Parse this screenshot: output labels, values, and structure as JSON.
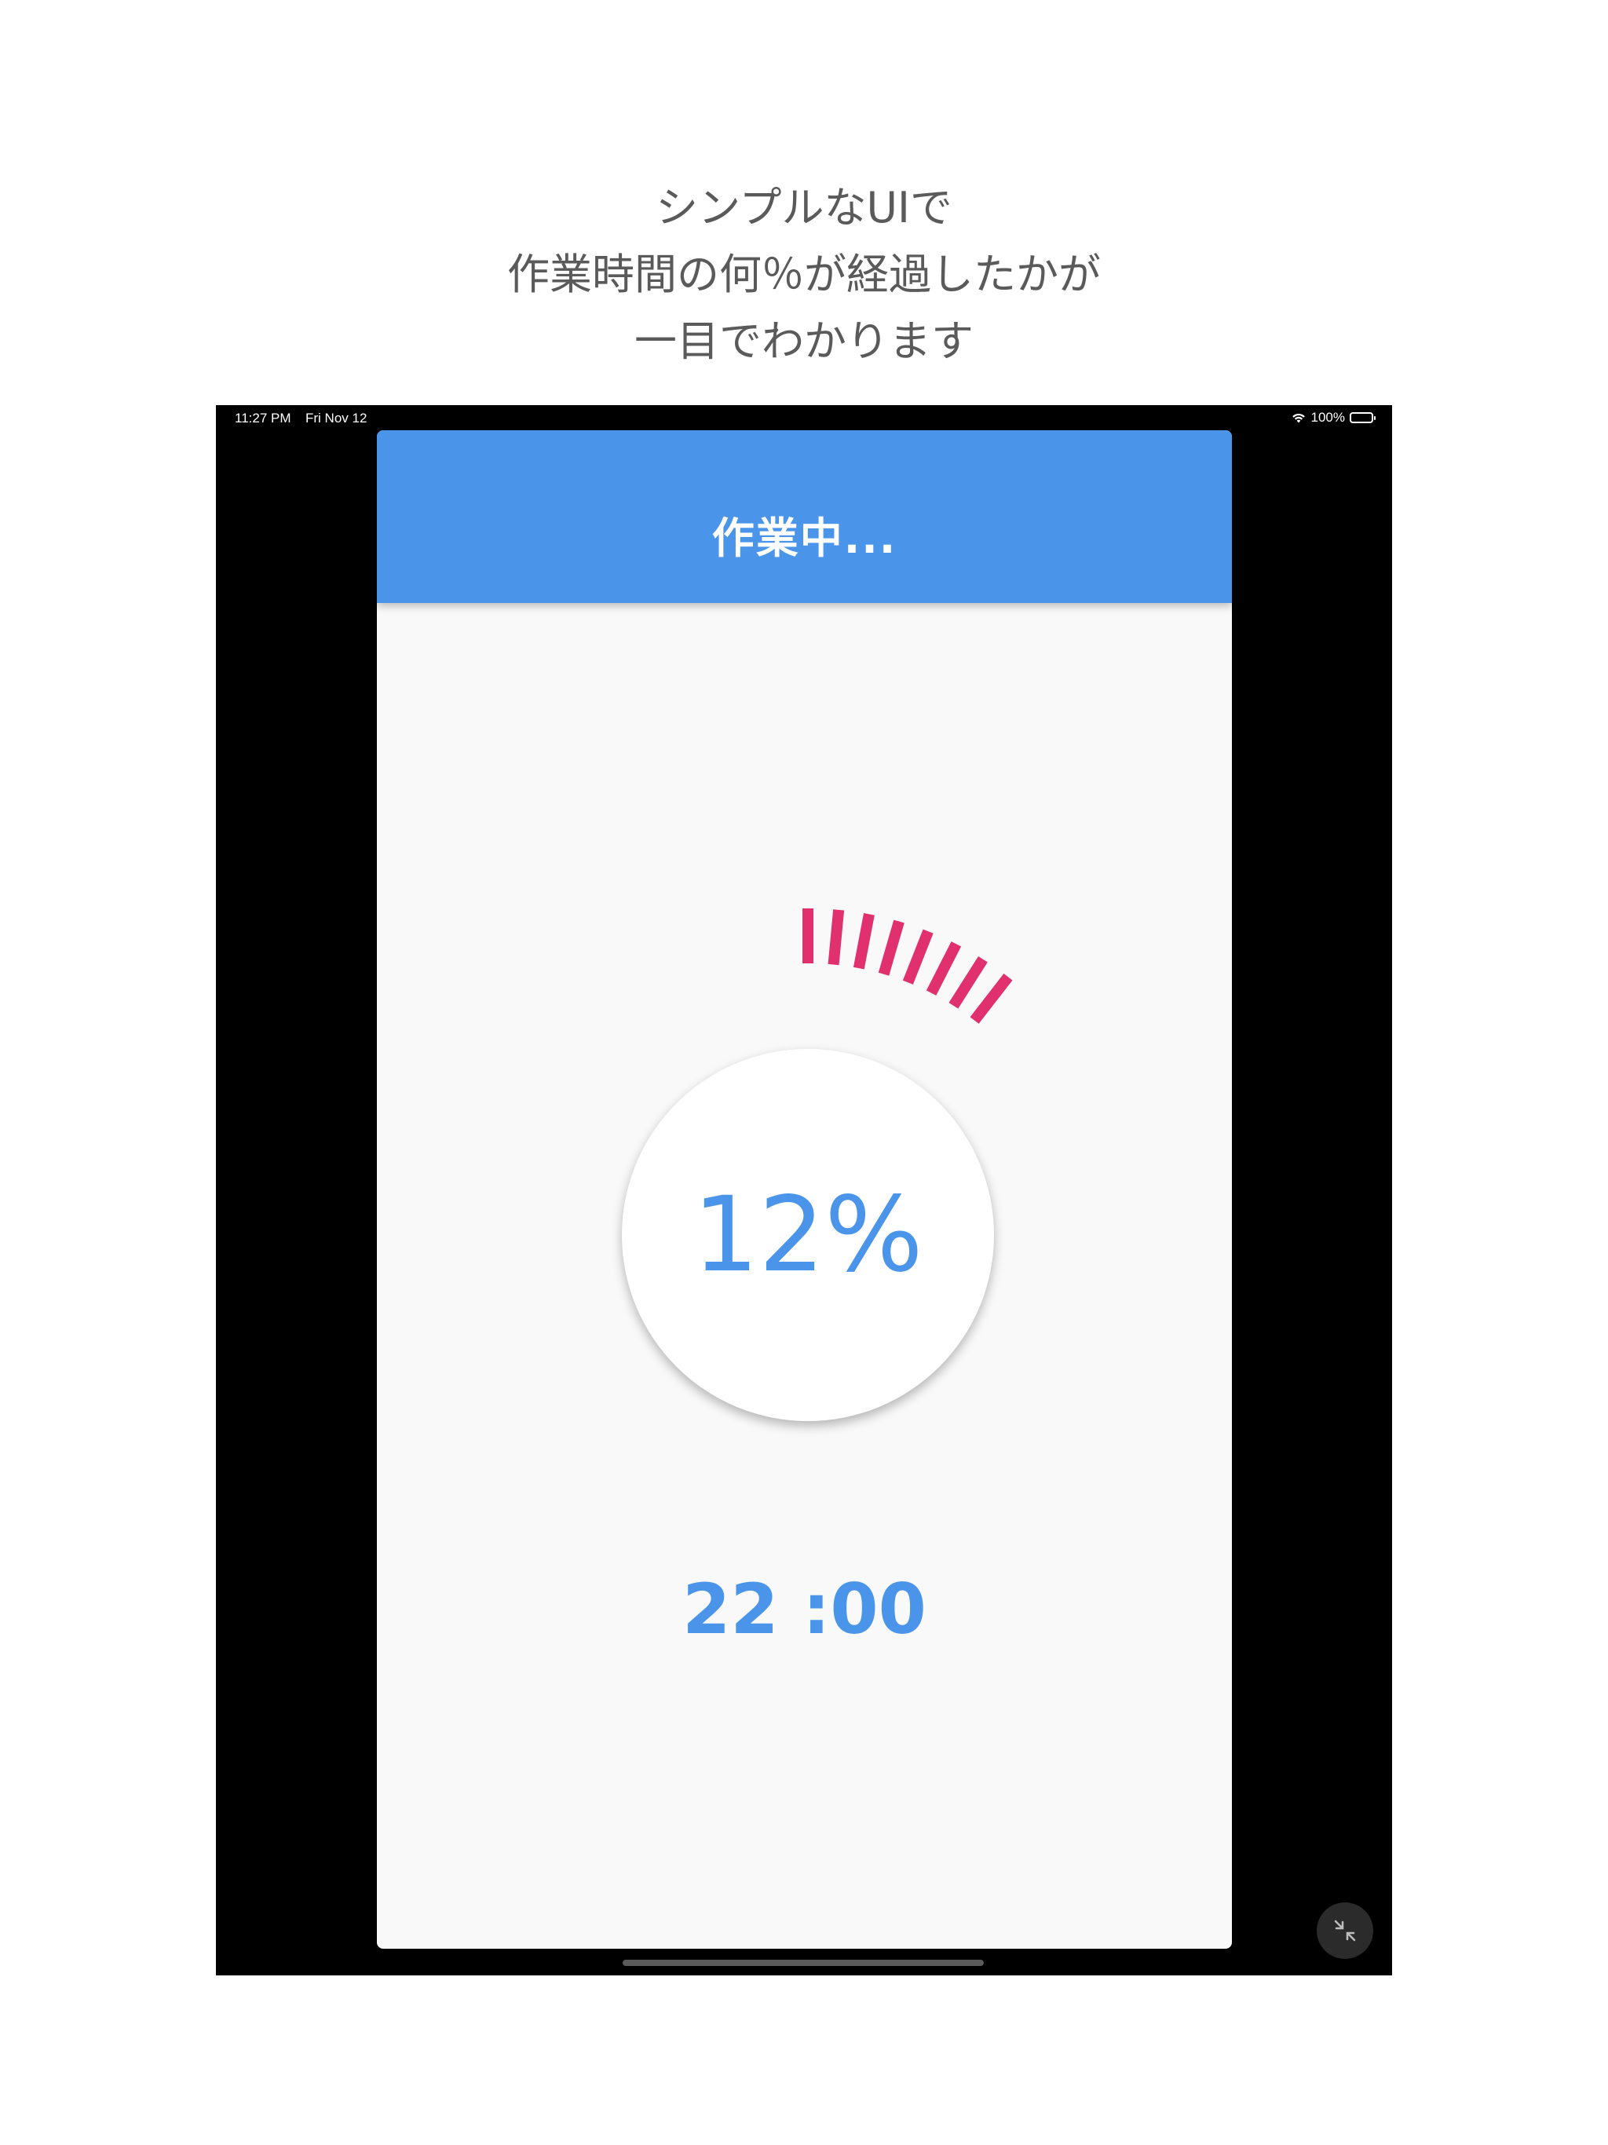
{
  "caption": {
    "line1": "シンプルなUIで",
    "line2": "作業時間の何％が経過したかが",
    "line3": "一目でわかります"
  },
  "status_bar": {
    "time": "11:27 PM",
    "date": "Fri Nov 12",
    "battery": "100%"
  },
  "app": {
    "title": "作業中...",
    "progress": {
      "percent_label": "12%",
      "value": 0.12
    },
    "timer": "22 :00"
  },
  "colors": {
    "accent": "#4a94ea",
    "tick": "#e0306e",
    "background": "#f9f9f9"
  },
  "icons": {
    "wifi": "wifi-icon",
    "battery": "battery-icon",
    "exit_fullscreen": "exit-fullscreen-icon"
  }
}
